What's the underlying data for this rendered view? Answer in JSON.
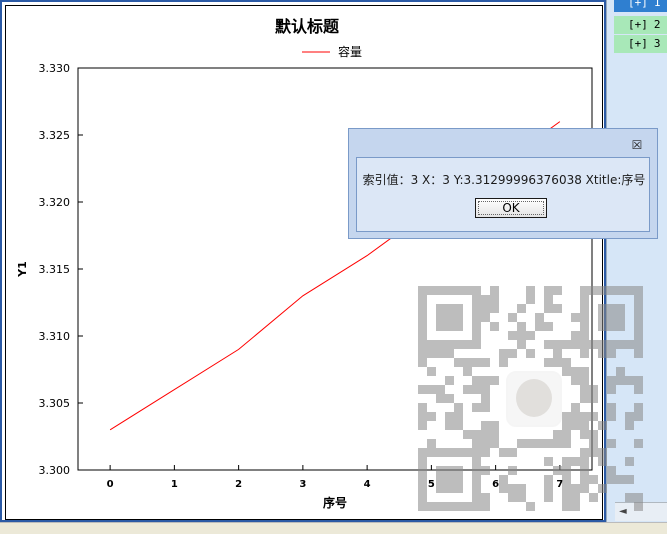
{
  "chart_data": {
    "type": "line",
    "title": "默认标题",
    "xlabel": "序号",
    "ylabel": "Y1",
    "legend": {
      "entries": [
        "容量"
      ],
      "placement": "top-center"
    },
    "x_ticks": [
      "0",
      "1",
      "2",
      "3",
      "4",
      "5",
      "6",
      "7"
    ],
    "y_ticks": [
      "3.300",
      "3.305",
      "3.310",
      "3.315",
      "3.320",
      "3.325",
      "3.330"
    ],
    "ylim": [
      3.3,
      3.33
    ],
    "xlim": [
      -0.5,
      7.5
    ],
    "grid": false,
    "series": [
      {
        "name": "容量",
        "color": "#ff0000",
        "x": [
          0,
          1,
          2,
          3,
          4,
          5,
          6,
          7
        ],
        "y": [
          3.303,
          3.306,
          3.309,
          3.313,
          3.316,
          3.3195,
          3.3225,
          3.326
        ]
      }
    ]
  },
  "tree": {
    "items": [
      {
        "marker": "[+]",
        "label": "1"
      },
      {
        "marker": "[+]",
        "label": "2"
      },
      {
        "marker": "[+]",
        "label": "3"
      }
    ]
  },
  "dialog": {
    "message": "索引值：3 X：3 Y:3.31299996376038 Xtitle:序号",
    "ok_label": "OK",
    "close_glyph": "☒"
  },
  "scroll": {
    "left_arrow": "◄"
  },
  "colors": {
    "accent": "#2b5aa5",
    "series": "#ff0000",
    "dialog_bg": "#c5d6ee"
  }
}
